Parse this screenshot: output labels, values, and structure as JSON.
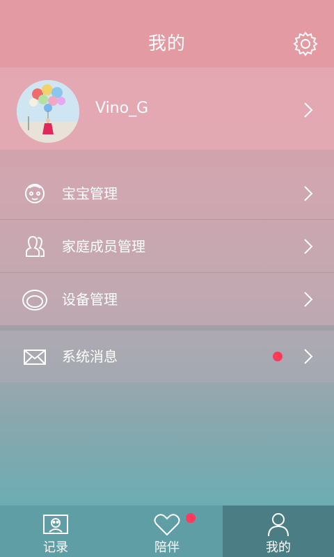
{
  "header": {
    "title": "我的",
    "settings_icon": "gear-icon"
  },
  "profile": {
    "username": "Vino_G",
    "avatar_icon": "avatar-balloons"
  },
  "menu": {
    "items": [
      {
        "label": "宝宝管理",
        "icon": "baby-face-icon"
      },
      {
        "label": "家庭成员管理",
        "icon": "users-icon"
      },
      {
        "label": "设备管理",
        "icon": "device-icon"
      }
    ],
    "messages": {
      "label": "系统消息",
      "icon": "envelope-icon",
      "has_unread": true
    }
  },
  "tabbar": {
    "tabs": [
      {
        "label": "记录",
        "icon": "record-icon",
        "active": false
      },
      {
        "label": "陪伴",
        "icon": "heart-icon",
        "active": false,
        "has_badge": true
      },
      {
        "label": "我的",
        "icon": "person-icon",
        "active": true
      }
    ]
  },
  "colors": {
    "badge": "#ff3a5c",
    "tab_active": "#4b7e84",
    "header": "#e39aa2"
  }
}
